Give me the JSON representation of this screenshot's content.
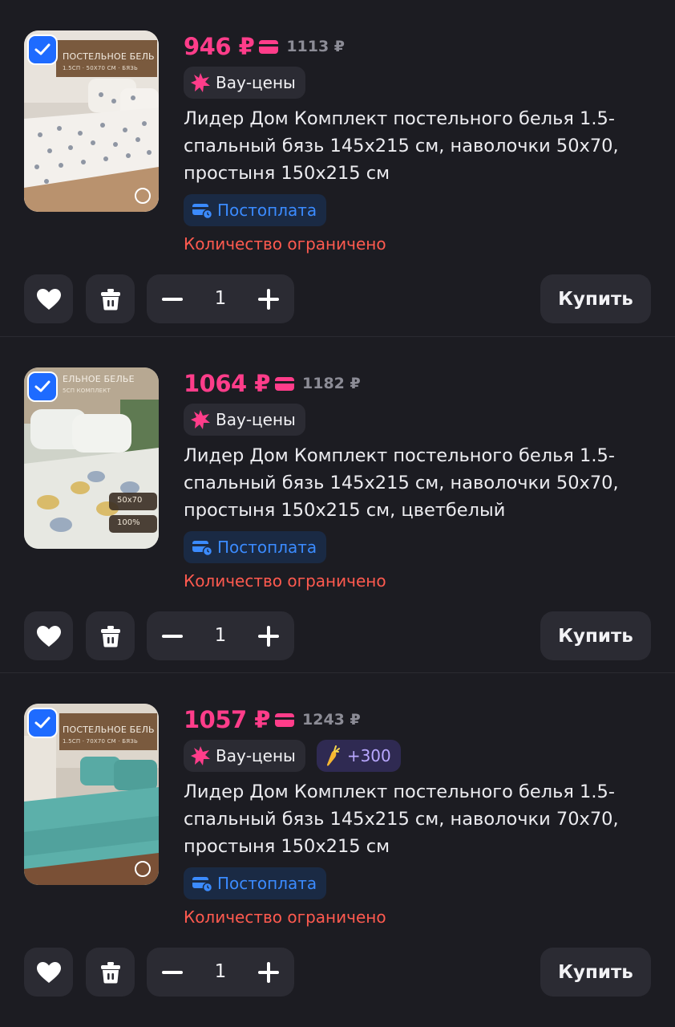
{
  "colors": {
    "price": "#ff3d8a",
    "checkbox": "#1e6bff",
    "postpay": "#3b8bff",
    "limited": "#ff5a4f",
    "points": "#b9a8ff"
  },
  "items": [
    {
      "checked": true,
      "thumbnail": {
        "caption": "ПОСТЕЛЬНОЕ БЕЛЬЕ",
        "subcaption": "1.5СП · 50X70 СМ · БЯЗЬ",
        "palette": [
          "#f3efe9",
          "#c9c3bb",
          "#8a8f9a"
        ],
        "icon": "bed-photo-stars"
      },
      "price": "946 ₽",
      "old_price": "1113 ₽",
      "wow_badge": "Вау-цены",
      "points_badge": null,
      "title": "Лидер Дом Комплект постельного белья 1.5-спальный бязь 145х215 см, наволочки 50х70, простыня 150х215 см",
      "postpay": "Постоплата",
      "limited": "Количество ограничено",
      "quantity": "1",
      "buy_label": "Купить"
    },
    {
      "checked": true,
      "thumbnail": {
        "caption": "ЕЛЬНОЕ БЕЛЬЕ",
        "subcaption": "5СП КОМПЛЕКТ",
        "size_tag": "50x70",
        "cotton_tag": "100%",
        "palette": [
          "#e9ebe4",
          "#b9c2b0",
          "#d8b35a"
        ],
        "icon": "bed-photo-leaves"
      },
      "price": "1064 ₽",
      "old_price": "1182 ₽",
      "wow_badge": "Вау-цены",
      "points_badge": null,
      "title": "Лидер Дом Комплект постельного белья 1.5-спальный бязь 145х215 см, наволочки 50х70, простыня 150х215 см, цветбелый",
      "postpay": "Постоплата",
      "limited": "Количество ограничено",
      "quantity": "1",
      "buy_label": "Купить"
    },
    {
      "checked": true,
      "thumbnail": {
        "caption": "ПОСТЕЛЬНОЕ БЕЛЬЕ",
        "subcaption": "1.5СП · 70X70 СМ · БЯЗЬ",
        "palette": [
          "#5fb3ad",
          "#3f8f8a",
          "#c9b8a4"
        ],
        "icon": "bed-photo-teal"
      },
      "price": "1057 ₽",
      "old_price": "1243 ₽",
      "wow_badge": "Вау-цены",
      "points_badge": "+300",
      "title": "Лидер Дом Комплект постельного белья 1.5-спальный бязь 145х215 см, наволочки 70х70, простыня 150х215 см",
      "postpay": "Постоплата",
      "limited": "Количество ограничено",
      "quantity": "1",
      "buy_label": "Купить"
    }
  ]
}
